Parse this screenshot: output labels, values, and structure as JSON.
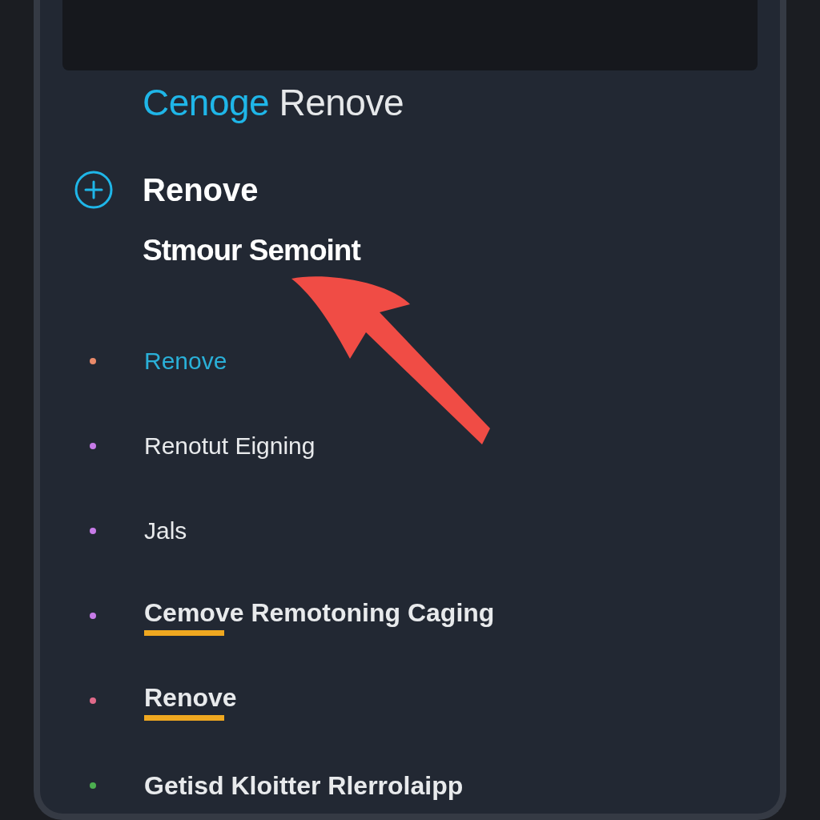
{
  "title": {
    "accent": "Cenoge",
    "rest": "Renove"
  },
  "heading": "Renove",
  "subheading": "Stmour Semoint",
  "items": [
    {
      "label": "Renove",
      "color": "#e98a6a",
      "selected": true,
      "underlined": false
    },
    {
      "label": "Renotut Eigning",
      "color": "#c77be8",
      "selected": false,
      "underlined": false
    },
    {
      "label": "Jals",
      "color": "#c77be8",
      "selected": false,
      "underlined": false
    },
    {
      "label": "Cemove Remotoning Caging",
      "color": "#c77be8",
      "selected": false,
      "underlined": true
    },
    {
      "label": "Renove",
      "color": "#e06a8a",
      "selected": false,
      "underlined": true
    },
    {
      "label": "Getisd Kloitter Rlerrolaipp",
      "color": "#4caf50",
      "selected": false,
      "underlined": false
    }
  ]
}
